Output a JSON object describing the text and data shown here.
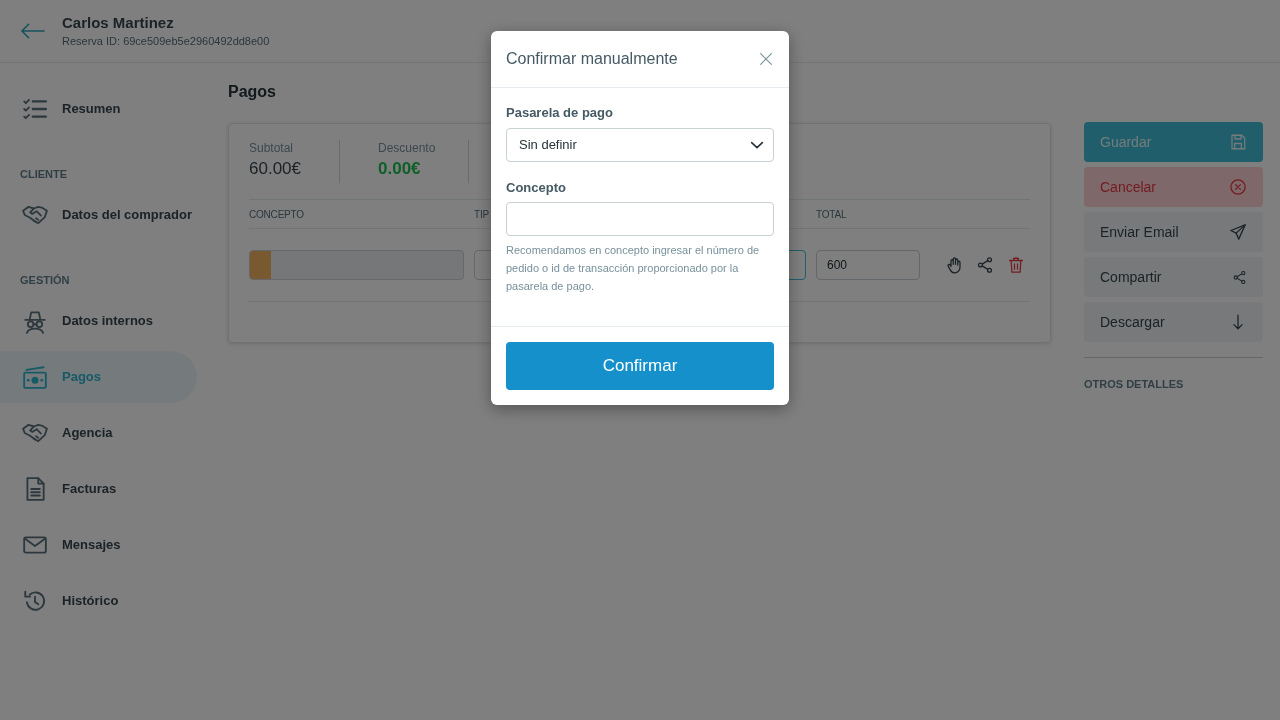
{
  "header": {
    "title": "Carlos Martinez",
    "subtitle": "Reserva ID: 69ce509eb5e2960492dd8e00"
  },
  "sidebar": {
    "sections": [
      {
        "items": [
          {
            "label": "Resumen",
            "selected": false
          }
        ]
      },
      {
        "heading": "CLIENTE",
        "items": [
          {
            "label": "Datos del comprador",
            "selected": false
          }
        ]
      },
      {
        "heading": "GESTIÓN",
        "items": [
          {
            "label": "Datos internos",
            "selected": false
          },
          {
            "label": "Pagos",
            "selected": true
          },
          {
            "label": "Agencia",
            "selected": false
          },
          {
            "label": "Facturas",
            "selected": false
          },
          {
            "label": "Mensajes",
            "selected": false
          },
          {
            "label": "Histórico",
            "selected": false
          }
        ]
      }
    ]
  },
  "payments": {
    "title": "Pagos",
    "summary": [
      {
        "label": "Subtotal",
        "value": "60.00€",
        "kind": "neutral"
      },
      {
        "label": "Descuento",
        "value": "0.00€",
        "kind": "positive"
      }
    ],
    "columns": [
      "CONCEPTO",
      "TIP",
      "TOTAL"
    ],
    "rows": [
      {
        "fields": [
          {
            "disabled": true,
            "focused": false
          },
          {
            "disabled": false,
            "focused": false
          },
          {
            "disabled": false,
            "focused": true
          },
          {
            "disabled": false,
            "focused": false,
            "value": "600"
          }
        ]
      }
    ]
  },
  "actions": [
    {
      "label": "Guardar",
      "kind": "primary"
    },
    {
      "label": "Cancelar",
      "kind": "danger"
    },
    {
      "label": "Enviar Email",
      "kind": "secondary"
    },
    {
      "label": "Compartir",
      "kind": "secondary"
    },
    {
      "label": "Descargar",
      "kind": "secondary"
    }
  ],
  "details_heading": "OTROS DETALLES",
  "modal": {
    "title": "Confirmar manualmente",
    "fields": [
      {
        "kind": "select",
        "label": "Pasarela de pago",
        "value": "Sin definir"
      },
      {
        "kind": "text",
        "label": "Concepto",
        "help": "Recomendamos en concepto ingresar el número de pedido o id de transacción proporcionado por la pasarela de pago."
      }
    ],
    "submit": "Confirmar"
  }
}
